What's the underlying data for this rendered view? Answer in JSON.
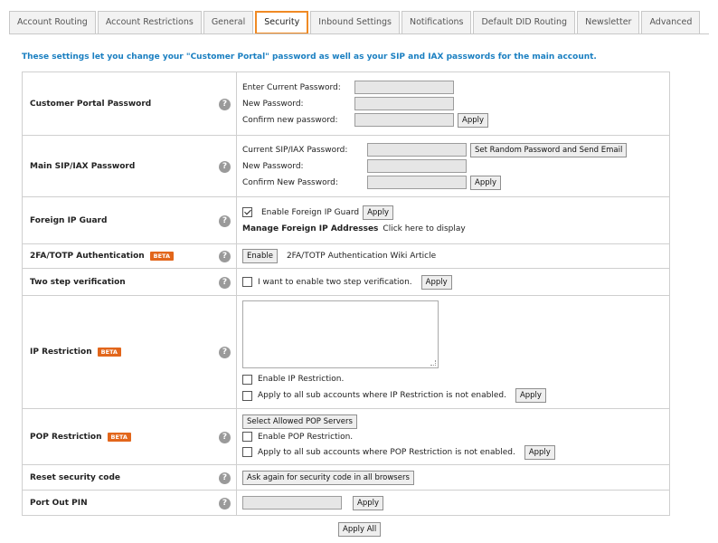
{
  "tabs": [
    {
      "label": "Account Routing"
    },
    {
      "label": "Account Restrictions"
    },
    {
      "label": "General"
    },
    {
      "label": "Security",
      "active": true
    },
    {
      "label": "Inbound Settings"
    },
    {
      "label": "Notifications"
    },
    {
      "label": "Default DID Routing"
    },
    {
      "label": "Newsletter"
    },
    {
      "label": "Advanced"
    }
  ],
  "intro": "These settings let you change your \"Customer Portal\" password as well as your SIP and IAX passwords for the main account.",
  "help_glyph": "?",
  "portal": {
    "label": "Customer Portal Password",
    "current": "Enter Current Password:",
    "new": "New Password:",
    "confirm": "Confirm new password:",
    "apply": "Apply"
  },
  "sip": {
    "label": "Main SIP/IAX Password",
    "current": "Current SIP/IAX Password:",
    "random_button": "Set Random Password and Send Email",
    "new": "New Password:",
    "confirm": "Confirm New Password:",
    "apply": "Apply"
  },
  "foreign": {
    "label": "Foreign IP Guard",
    "enable": "Enable Foreign IP Guard",
    "enabled": true,
    "apply": "Apply",
    "manage_label": "Manage Foreign IP Addresses",
    "manage_link": "Click here to display"
  },
  "twofa": {
    "label": "2FA/TOTP Authentication",
    "badge": "BETA",
    "enable_button": "Enable",
    "wiki_link": "2FA/TOTP Authentication Wiki Article"
  },
  "twostep": {
    "label": "Two step verification",
    "checkbox": "I want to enable two step verification.",
    "apply": "Apply"
  },
  "ip": {
    "label": "IP Restriction",
    "badge": "BETA",
    "enable": "Enable IP Restriction.",
    "apply_all_sub": "Apply to all sub accounts where IP Restriction is not enabled.",
    "apply": "Apply"
  },
  "pop": {
    "label": "POP Restriction",
    "badge": "BETA",
    "select_button": "Select Allowed POP Servers",
    "enable": "Enable POP Restriction.",
    "apply_all_sub": "Apply to all sub accounts where POP Restriction is not enabled.",
    "apply": "Apply"
  },
  "reset": {
    "label": "Reset security code",
    "button": "Ask again for security code in all browsers"
  },
  "portout": {
    "label": "Port Out PIN",
    "apply": "Apply"
  },
  "apply_all": "Apply All"
}
